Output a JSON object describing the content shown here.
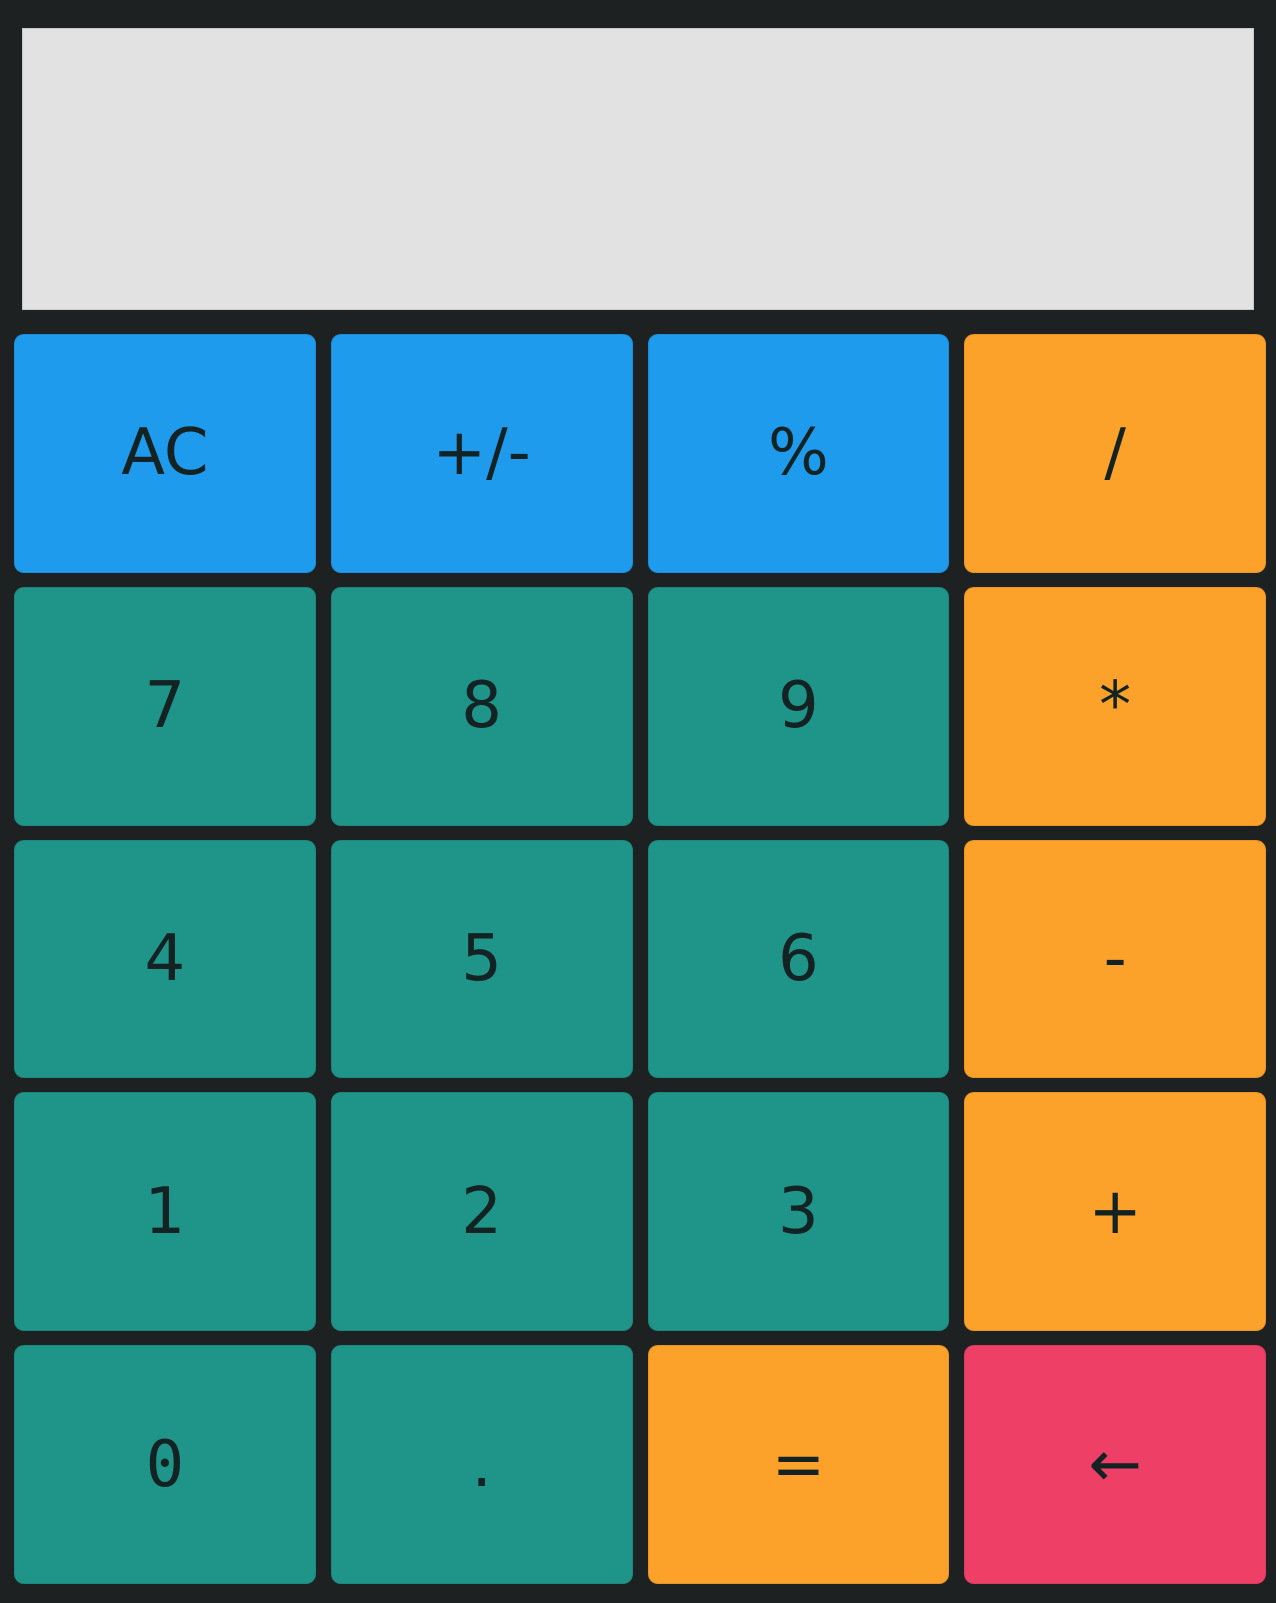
{
  "display": {
    "value": ""
  },
  "keys": {
    "ac": "AC",
    "sign": "+/-",
    "percent": "%",
    "divide": "/",
    "seven": "7",
    "eight": "8",
    "nine": "9",
    "multiply": "*",
    "four": "4",
    "five": "5",
    "six": "6",
    "subtract": "-",
    "one": "1",
    "two": "2",
    "three": "3",
    "add": "+",
    "zero": "0",
    "decimal": ".",
    "equals": "=",
    "backspace": "←"
  },
  "colors": {
    "function_keys": "#1e9bec",
    "number_keys": "#1f9488",
    "operator_keys": "#fca12a",
    "backspace_key": "#ee3f67",
    "display_background": "#e2e2e2",
    "frame_background": "#1e2121"
  }
}
